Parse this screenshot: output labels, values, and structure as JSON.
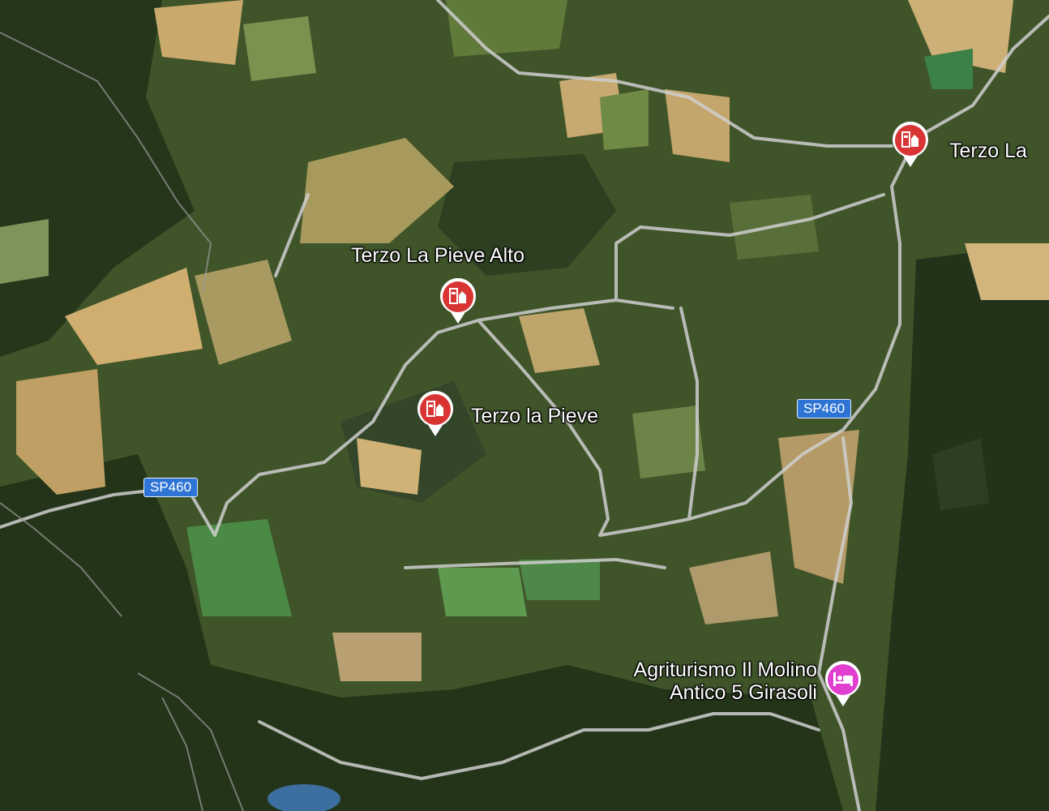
{
  "map": {
    "type": "satellite",
    "places": [
      {
        "name": "Terzo La",
        "icon": "historic-site-icon",
        "color": "#d93434"
      },
      {
        "name": "Terzo La Pieve Alto",
        "icon": "historic-site-icon",
        "color": "#d93434"
      },
      {
        "name": "Terzo la Pieve",
        "icon": "historic-site-icon",
        "color": "#d93434"
      },
      {
        "name_line1": "Agriturismo Il Molino",
        "name_line2": "Antico 5 Girasoli",
        "icon": "hotel-bed-icon",
        "color": "#e13fd0"
      }
    ],
    "roads": [
      {
        "label": "SP460"
      },
      {
        "label": "SP460"
      }
    ]
  }
}
